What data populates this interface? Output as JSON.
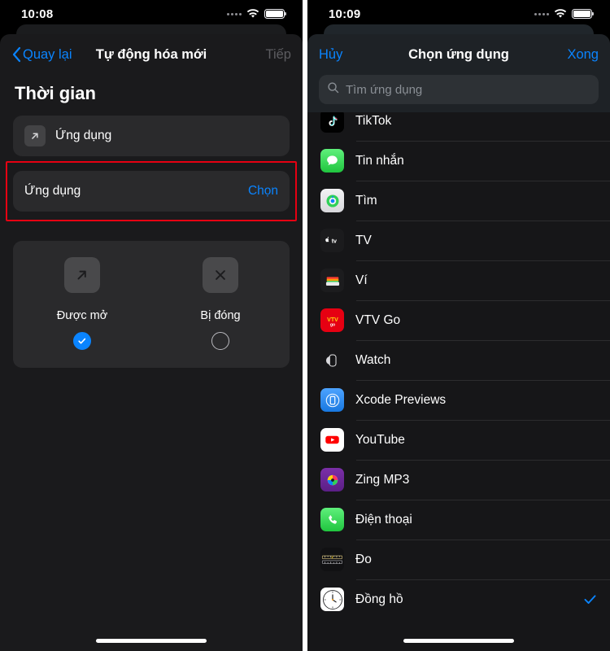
{
  "left": {
    "status": {
      "time": "10:08"
    },
    "nav": {
      "back": "Quay lại",
      "title": "Tự động hóa mới",
      "next": "Tiếp"
    },
    "section_title": "Thời gian",
    "app_row": {
      "label": "Ứng dụng"
    },
    "choose_row": {
      "label": "Ứng dụng",
      "action": "Chọn"
    },
    "options": [
      {
        "label": "Được mở",
        "selected": true,
        "icon": "arrow-up-right-icon"
      },
      {
        "label": "Bị đóng",
        "selected": false,
        "icon": "close-x-icon"
      }
    ],
    "highlight_color": "#e60012"
  },
  "right": {
    "status": {
      "time": "10:09"
    },
    "nav": {
      "cancel": "Hủy",
      "title": "Chọn ứng dụng",
      "done": "Xong"
    },
    "search": {
      "placeholder": "Tìm ứng dụng"
    },
    "apps": [
      {
        "name": "TikTok",
        "icon": "tiktok-icon",
        "selected": false,
        "clipped": true
      },
      {
        "name": "Tin nhắn",
        "icon": "messages-icon",
        "selected": false
      },
      {
        "name": "Tìm",
        "icon": "find-my-icon",
        "selected": false
      },
      {
        "name": "TV",
        "icon": "apple-tv-icon",
        "selected": false
      },
      {
        "name": "Ví",
        "icon": "wallet-icon",
        "selected": false
      },
      {
        "name": "VTV Go",
        "icon": "vtv-go-icon",
        "selected": false
      },
      {
        "name": "Watch",
        "icon": "apple-watch-icon",
        "selected": false
      },
      {
        "name": "Xcode Previews",
        "icon": "xcode-previews-icon",
        "selected": false
      },
      {
        "name": "YouTube",
        "icon": "youtube-icon",
        "selected": false
      },
      {
        "name": "Zing MP3",
        "icon": "zing-mp3-icon",
        "selected": false
      },
      {
        "name": "Điện thoại",
        "icon": "phone-icon",
        "selected": false
      },
      {
        "name": "Đo",
        "icon": "measure-icon",
        "selected": false
      },
      {
        "name": "Đồng hồ",
        "icon": "clock-icon",
        "selected": true
      }
    ],
    "accent_color": "#0a84ff"
  }
}
